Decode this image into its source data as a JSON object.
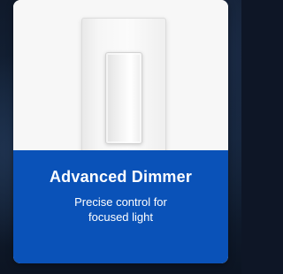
{
  "card": {
    "title": "Advanced Dimmer",
    "description_line1": "Precise control for",
    "description_line2": "focused light",
    "image_subject": "white-wall-dimmer-switch"
  },
  "colors": {
    "banner": "#0a52b8",
    "card_background": "#ffffff",
    "page_background": "#0e1626"
  }
}
